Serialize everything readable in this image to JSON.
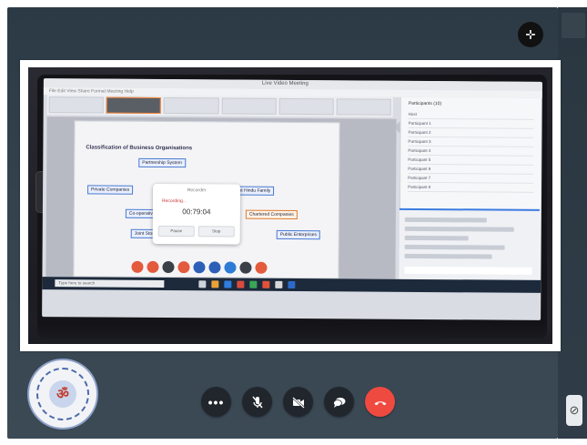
{
  "meeting_app": {
    "window_title": "Live Video Meeting",
    "menu_text": "File  Edit  View  Share  Format  Meeting  Help"
  },
  "document": {
    "heading": "Classification of Business Organisations",
    "boxes": [
      "Partnership System",
      "Private Companies",
      "Joint Hindu Family",
      "Co-operative Societies",
      "Chartered Companies",
      "Joint Stock Company",
      "Public Enterprises"
    ]
  },
  "recorder": {
    "title": "Recorder",
    "status": "Recording...",
    "time": "00:79:04",
    "pause_label": "Pause",
    "stop_label": "Stop"
  },
  "participants_panel": {
    "title": "Participants (10)",
    "rows": [
      "Host",
      "Participant 1",
      "Participant 2",
      "Participant 3",
      "Participant 4",
      "Participant 5",
      "Participant 6",
      "Participant 7",
      "Participant 8"
    ]
  },
  "taskbar": {
    "search_placeholder": "Type here to search"
  },
  "toolbar": {
    "more_icon": "ellipsis-icon",
    "mute_icon": "microphone-muted-icon",
    "video_icon": "video-off-icon",
    "chat_icon": "chat-bubble-icon",
    "end_icon": "phone-hangup-icon",
    "end_color": "#ef4a40"
  },
  "logo": {
    "glyph": "ॐ",
    "ring_text": "VAISHNAVI DEGREE COLLEGE OF COMMERCE"
  }
}
